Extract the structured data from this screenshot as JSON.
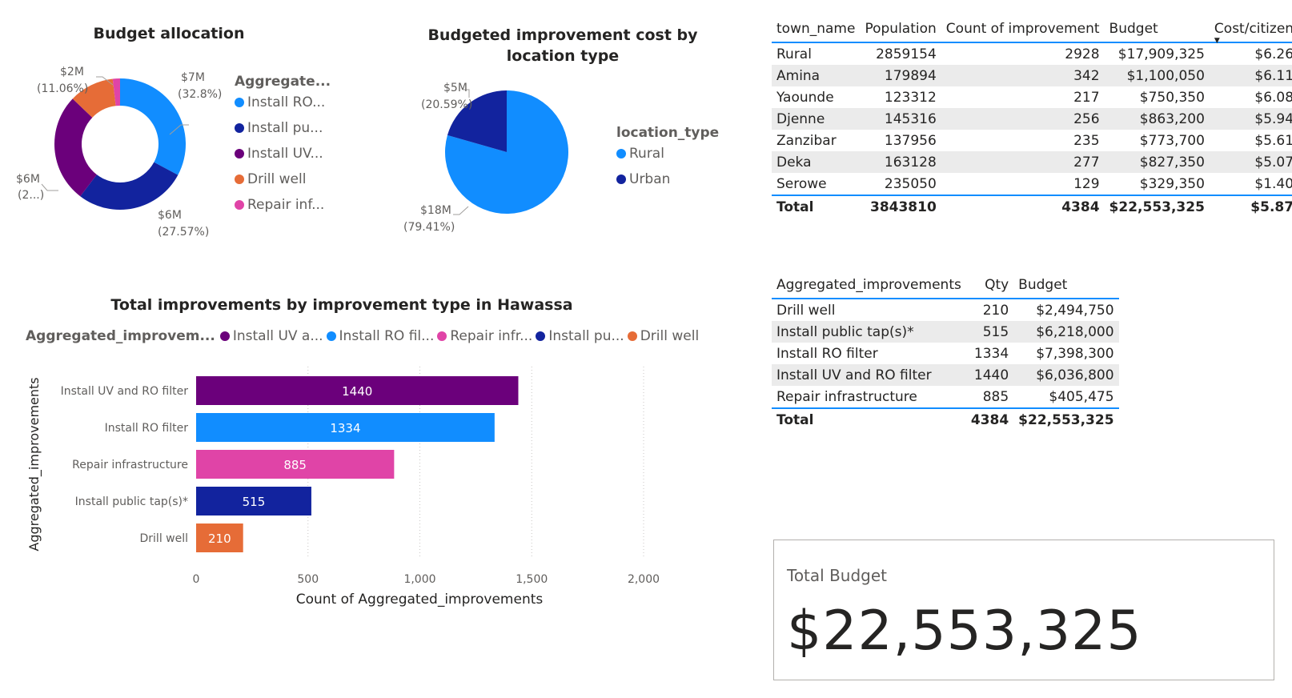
{
  "colors": {
    "rural": "#118DFF",
    "urban": "#12239E",
    "uv_ro": "#6B007B",
    "ro": "#118DFF",
    "repair": "#E044A7",
    "tap": "#12239E",
    "drill": "#E66C37",
    "accent": "#118DFF"
  },
  "donut": {
    "title": "Budget allocation",
    "legend_title": "Aggregate...",
    "legend": [
      {
        "label": "Install RO...",
        "color": "#118DFF"
      },
      {
        "label": "Install pu...",
        "color": "#12239E"
      },
      {
        "label": "Install UV...",
        "color": "#6B007B"
      },
      {
        "label": "Drill well",
        "color": "#E66C37"
      },
      {
        "label": "Repair inf...",
        "color": "#E044A7"
      }
    ],
    "labels": {
      "ro_val": "$7M",
      "ro_pct": "(32.8%)",
      "tap_val": "$6M",
      "tap_pct": "(27.57%)",
      "uv_val": "$6M",
      "uv_pct": "(2...)",
      "drill_val": "$2M",
      "drill_pct": "(11.06%)"
    }
  },
  "pie": {
    "title": "Budgeted improvement cost by location type",
    "legend_title": "location_type",
    "legend": [
      {
        "label": "Rural",
        "color": "#118DFF"
      },
      {
        "label": "Urban",
        "color": "#12239E"
      }
    ],
    "labels": {
      "urban_val": "$5M",
      "urban_pct": "(20.59%)",
      "rural_val": "$18M",
      "rural_pct": "(79.41%)"
    }
  },
  "bar": {
    "title": "Total improvements by improvement type in Hawassa",
    "legend_title": "Aggregated_improvem...",
    "legend": [
      {
        "label": "Install UV a...",
        "color": "#6B007B"
      },
      {
        "label": "Install RO fil...",
        "color": "#118DFF"
      },
      {
        "label": "Repair infr...",
        "color": "#E044A7"
      },
      {
        "label": "Install pu...",
        "color": "#12239E"
      },
      {
        "label": "Drill well",
        "color": "#E66C37"
      }
    ],
    "ylabel": "Aggregated_improvements",
    "xlabel": "Count of Aggregated_improvements",
    "ticks": [
      "0",
      "500",
      "1,000",
      "1,500",
      "2,000"
    ]
  },
  "town_table": {
    "headers": [
      "town_name",
      "Population",
      "Count of improvement",
      "Budget",
      "Cost/citizen"
    ],
    "rows": [
      [
        "Rural",
        "2859154",
        "2928",
        "$17,909,325",
        "$6.26"
      ],
      [
        "Amina",
        "179894",
        "342",
        "$1,100,050",
        "$6.11"
      ],
      [
        "Yaounde",
        "123312",
        "217",
        "$750,350",
        "$6.08"
      ],
      [
        "Djenne",
        "145316",
        "256",
        "$863,200",
        "$5.94"
      ],
      [
        "Zanzibar",
        "137956",
        "235",
        "$773,700",
        "$5.61"
      ],
      [
        "Deka",
        "163128",
        "277",
        "$827,350",
        "$5.07"
      ],
      [
        "Serowe",
        "235050",
        "129",
        "$329,350",
        "$1.40"
      ]
    ],
    "total": [
      "Total",
      "3843810",
      "4384",
      "$22,553,325",
      "$5.87"
    ]
  },
  "improve_table": {
    "headers": [
      "Aggregated_improvements",
      "Qty",
      "Budget"
    ],
    "rows": [
      [
        "Drill well",
        "210",
        "$2,494,750"
      ],
      [
        "Install public tap(s)*",
        "515",
        "$6,218,000"
      ],
      [
        "Install RO filter",
        "1334",
        "$7,398,300"
      ],
      [
        "Install UV and RO filter",
        "1440",
        "$6,036,800"
      ],
      [
        "Repair infrastructure",
        "885",
        "$405,475"
      ]
    ],
    "total": [
      "Total",
      "4384",
      "$22,553,325"
    ]
  },
  "card": {
    "label": "Total Budget",
    "value": "$22,553,325"
  },
  "chart_data": [
    {
      "type": "pie",
      "title": "Budget allocation",
      "categories": [
        "Install RO filter",
        "Install public tap(s)*",
        "Install UV and RO filter",
        "Drill well",
        "Repair infrastructure"
      ],
      "values": [
        7398300,
        6218000,
        6036800,
        2494750,
        405475
      ],
      "percent_labels": [
        "32.8%",
        "27.57%",
        "2...",
        "11.06%",
        ""
      ],
      "legend_title": "Aggregate...",
      "legend_position": "right"
    },
    {
      "type": "pie",
      "title": "Budgeted improvement cost by location type",
      "categories": [
        "Rural",
        "Urban"
      ],
      "values": [
        79.41,
        20.59
      ],
      "value_labels": [
        "$18M",
        "$5M"
      ],
      "legend_title": "location_type",
      "legend_position": "right"
    },
    {
      "type": "bar",
      "orientation": "horizontal",
      "title": "Total improvements by improvement type in Hawassa",
      "categories": [
        "Install UV and RO filter",
        "Install RO filter",
        "Repair infrastructure",
        "Install public tap(s)*",
        "Drill well"
      ],
      "values": [
        1440,
        1334,
        885,
        515,
        210
      ],
      "colors": [
        "#6B007B",
        "#118DFF",
        "#E044A7",
        "#12239E",
        "#E66C37"
      ],
      "xlabel": "Count of Aggregated_improvements",
      "ylabel": "Aggregated_improvements",
      "xlim": [
        0,
        2000
      ],
      "grid": true,
      "legend_position": "top"
    }
  ]
}
